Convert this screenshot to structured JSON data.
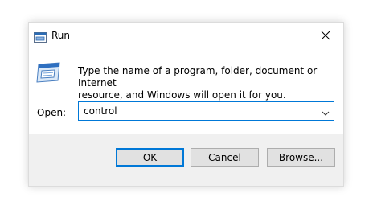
{
  "window": {
    "title": "Run",
    "title_icon": "run-icon",
    "close_icon": "close-icon"
  },
  "content": {
    "message": "Type the name of a program, folder, document or Internet\nresource, and Windows will open it for you.",
    "open_label": "Open:",
    "open_value": "control",
    "dropdown_icon": "chevron-down-icon"
  },
  "buttons": {
    "ok": "OK",
    "cancel": "Cancel",
    "browse": "Browse..."
  },
  "colors": {
    "accent": "#0078d7",
    "footer_bg": "#f0f0f0",
    "button_bg": "#e1e1e1"
  }
}
